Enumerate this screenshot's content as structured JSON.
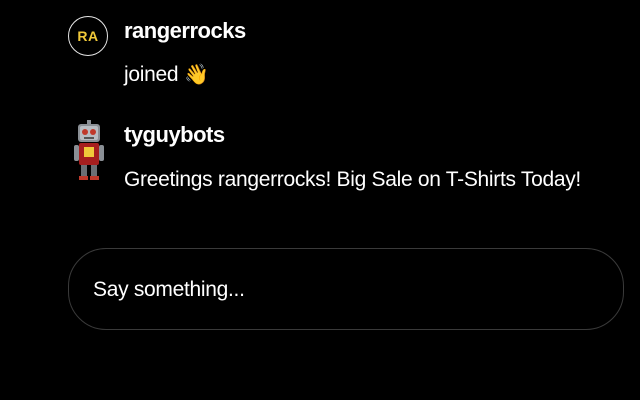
{
  "messages": [
    {
      "avatar_initials": "RA",
      "avatar_icon": "initials-avatar",
      "username": "rangerrocks",
      "text": "joined",
      "emoji": "👋",
      "emoji_icon": "waving-hand-icon"
    },
    {
      "avatar_icon": "bot-avatar-icon",
      "username": "tyguybots",
      "text": "Greetings rangerrocks! Big Sale on T-Shirts Today!"
    }
  ],
  "composer": {
    "placeholder": "Say something..."
  },
  "colors": {
    "background": "#000000",
    "text": "#ffffff",
    "initials": "#f0c93a",
    "composer_border": "#3a3a3a"
  }
}
